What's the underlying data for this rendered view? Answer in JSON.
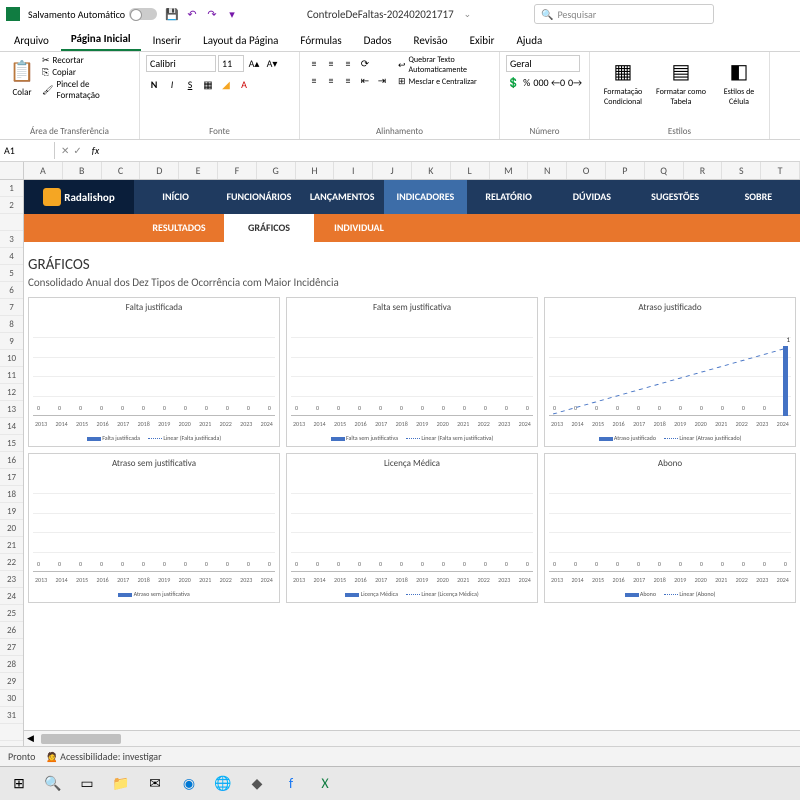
{
  "titlebar": {
    "autosave": "Salvamento Automático",
    "filename": "ControleDeFaltas-202402021717",
    "search_placeholder": "Pesquisar"
  },
  "menu": [
    "Arquivo",
    "Página Inicial",
    "Inserir",
    "Layout da Página",
    "Fórmulas",
    "Dados",
    "Revisão",
    "Exibir",
    "Ajuda"
  ],
  "menu_active": 1,
  "ribbon": {
    "clipboard": {
      "paste": "Colar",
      "cut": "Recortar",
      "copy": "Copiar",
      "painter": "Pincel de Formatação",
      "group": "Área de Transferência"
    },
    "font": {
      "name": "Calibri",
      "size": "11",
      "group": "Fonte"
    },
    "alignment": {
      "wrap": "Quebrar Texto Automaticamente",
      "merge": "Mesclar e Centralizar",
      "group": "Alinhamento"
    },
    "number": {
      "format": "Geral",
      "group": "Número"
    },
    "styles": {
      "cond": "Formatação Condicional",
      "table": "Formatar como Tabela",
      "cell": "Estilos de Célula",
      "group": "Estilos"
    }
  },
  "namebox": "A1",
  "columns": [
    "A",
    "B",
    "C",
    "D",
    "E",
    "F",
    "G",
    "H",
    "I",
    "J",
    "K",
    "L",
    "M",
    "N",
    "O",
    "P",
    "Q",
    "R",
    "S",
    "T"
  ],
  "rows": [
    "1",
    "2",
    "",
    "3",
    "4",
    "5",
    "6",
    "7",
    "8",
    "9",
    "10",
    "11",
    "12",
    "13",
    "14",
    "15",
    "16",
    "17",
    "18",
    "19",
    "20",
    "21",
    "22",
    "23",
    "24",
    "25",
    "26",
    "27",
    "28",
    "29",
    "30",
    "31",
    ""
  ],
  "app_nav": {
    "brand": "Radalishop",
    "items": [
      "INÍCIO",
      "FUNCIONÁRIOS",
      "LANÇAMENTOS",
      "INDICADORES",
      "RELATÓRIO",
      "DÚVIDAS",
      "SUGESTÕES",
      "SOBRE"
    ],
    "active": 3
  },
  "sub_nav": {
    "items": [
      "RESULTADOS",
      "GRÁFICOS",
      "INDIVIDUAL"
    ],
    "active": 1
  },
  "section": {
    "title": "GRÁFICOS",
    "subtitle": "Consolidado Anual dos Dez Tipos de Ocorrência com Maior Incidência"
  },
  "chart_data": [
    {
      "type": "bar",
      "title": "Falta justificada",
      "categories": [
        "2013",
        "2014",
        "2015",
        "2016",
        "2017",
        "2018",
        "2019",
        "2020",
        "2021",
        "2022",
        "2023",
        "2024"
      ],
      "values": [
        0,
        0,
        0,
        0,
        0,
        0,
        0,
        0,
        0,
        0,
        0,
        0
      ],
      "series_name": "Falta justificada",
      "trend_name": "Linear (Falta justificada)"
    },
    {
      "type": "bar",
      "title": "Falta sem justificativa",
      "categories": [
        "2013",
        "2014",
        "2015",
        "2016",
        "2017",
        "2018",
        "2019",
        "2020",
        "2021",
        "2022",
        "2023",
        "2024"
      ],
      "values": [
        0,
        0,
        0,
        0,
        0,
        0,
        0,
        0,
        0,
        0,
        0,
        0
      ],
      "series_name": "Falta sem justificativa",
      "trend_name": "Linear (Falta sem justificativa)"
    },
    {
      "type": "bar",
      "title": "Atraso justificado",
      "categories": [
        "2013",
        "2014",
        "2015",
        "2016",
        "2017",
        "2018",
        "2019",
        "2020",
        "2021",
        "2022",
        "2023",
        "2024"
      ],
      "values": [
        0,
        0,
        0,
        0,
        0,
        0,
        0,
        0,
        0,
        0,
        0,
        1
      ],
      "series_name": "Atraso justificado",
      "trend_name": "Linear (Atraso justificado)"
    },
    {
      "type": "bar",
      "title": "Atraso sem justificativa",
      "categories": [
        "2013",
        "2014",
        "2015",
        "2016",
        "2017",
        "2018",
        "2019",
        "2020",
        "2021",
        "2022",
        "2023",
        "2024"
      ],
      "values": [
        0,
        0,
        0,
        0,
        0,
        0,
        0,
        0,
        0,
        0,
        0,
        0
      ],
      "series_name": "Atraso sem justificativa",
      "trend_name": ""
    },
    {
      "type": "bar",
      "title": "Licença Médica",
      "categories": [
        "2013",
        "2014",
        "2015",
        "2016",
        "2017",
        "2018",
        "2019",
        "2020",
        "2021",
        "2022",
        "2023",
        "2024"
      ],
      "values": [
        0,
        0,
        0,
        0,
        0,
        0,
        0,
        0,
        0,
        0,
        0,
        0
      ],
      "series_name": "Licença Médica",
      "trend_name": "Linear (Licença Médica)"
    },
    {
      "type": "bar",
      "title": "Abono",
      "categories": [
        "2013",
        "2014",
        "2015",
        "2016",
        "2017",
        "2018",
        "2019",
        "2020",
        "2021",
        "2022",
        "2023",
        "2024"
      ],
      "values": [
        0,
        0,
        0,
        0,
        0,
        0,
        0,
        0,
        0,
        0,
        0,
        0
      ],
      "series_name": "Abono",
      "trend_name": "Linear (Abono)"
    }
  ],
  "status": {
    "ready": "Pronto",
    "access": "Acessibilidade: investigar"
  }
}
